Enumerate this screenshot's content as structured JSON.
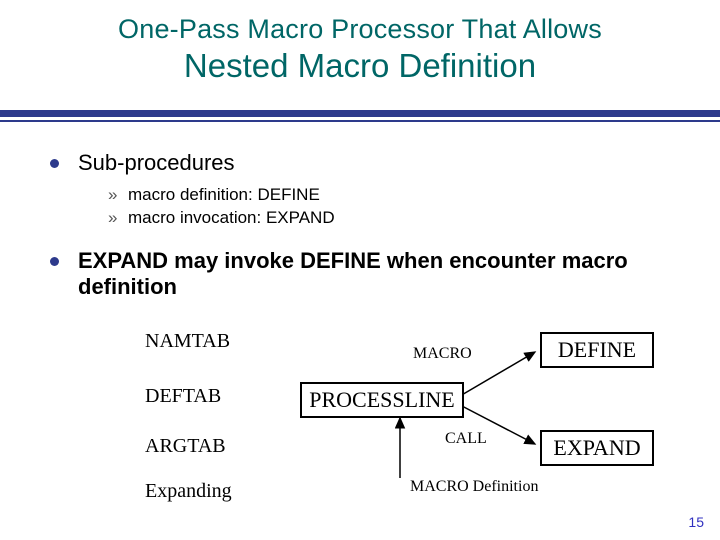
{
  "title": {
    "line1": "One-Pass Macro Processor That Allows",
    "line2": "Nested Macro Definition"
  },
  "bullets": {
    "b1": "Sub-procedures",
    "b1a": "macro definition: DEFINE",
    "b1b": "macro invocation: EXPAND",
    "b2": "EXPAND may invoke DEFINE when encounter macro definition"
  },
  "diagram": {
    "namtab": "NAMTAB",
    "deftab": "DEFTAB",
    "argtab": "ARGTAB",
    "expanding": "Expanding",
    "processline": "PROCESSLINE",
    "define": "DEFINE",
    "expand": "EXPAND",
    "macro": "MACRO",
    "call": "CALL",
    "macro_def": "MACRO Definition"
  },
  "page_number": "15"
}
